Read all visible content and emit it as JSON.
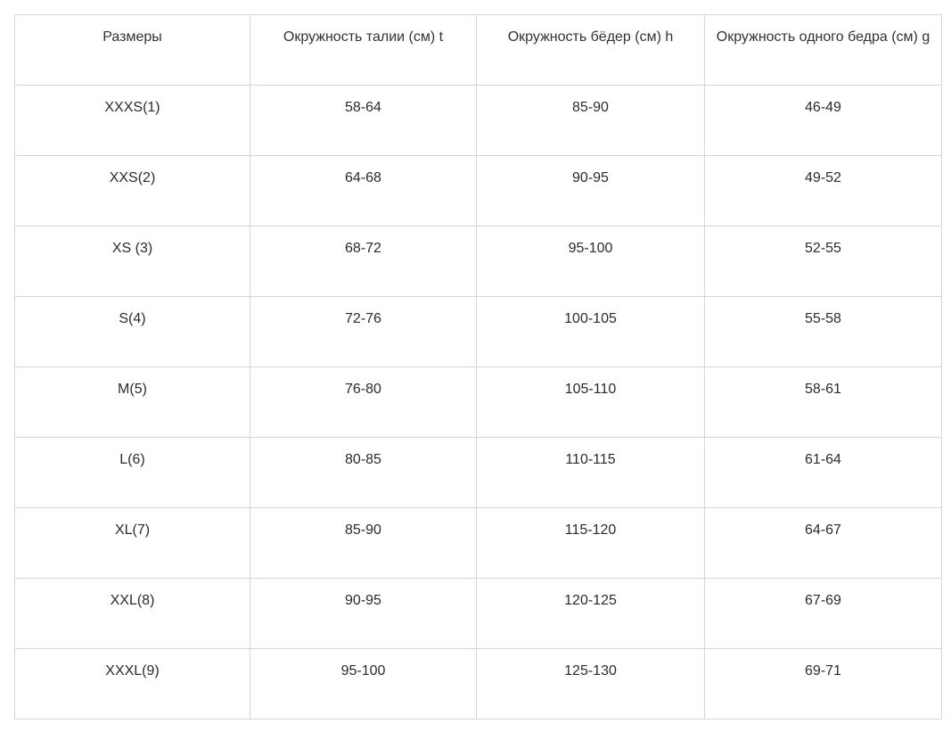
{
  "table": {
    "headers": [
      "Размеры",
      "Окружность талии (см) t",
      "Окружность бёдер (см) h",
      "Окружность одного бедра (см) g"
    ],
    "rows": [
      [
        "XXXS(1)",
        "58-64",
        "85-90",
        "46-49"
      ],
      [
        "XXS(2)",
        "64-68",
        "90-95",
        "49-52"
      ],
      [
        "XS (3)",
        "68-72",
        "95-100",
        "52-55"
      ],
      [
        "S(4)",
        "72-76",
        "100-105",
        "55-58"
      ],
      [
        "M(5)",
        "76-80",
        "105-110",
        "58-61"
      ],
      [
        "L(6)",
        "80-85",
        "110-115",
        "61-64"
      ],
      [
        "XL(7)",
        "85-90",
        "115-120",
        "64-67"
      ],
      [
        "XXL(8)",
        "90-95",
        "120-125",
        "67-69"
      ],
      [
        "XXXL(9)",
        "95-100",
        "125-130",
        "69-71"
      ]
    ],
    "colors": {
      "border": "#d6d6d6",
      "text": "#2b2b2b",
      "muted_text": "#6e6e6e"
    }
  }
}
